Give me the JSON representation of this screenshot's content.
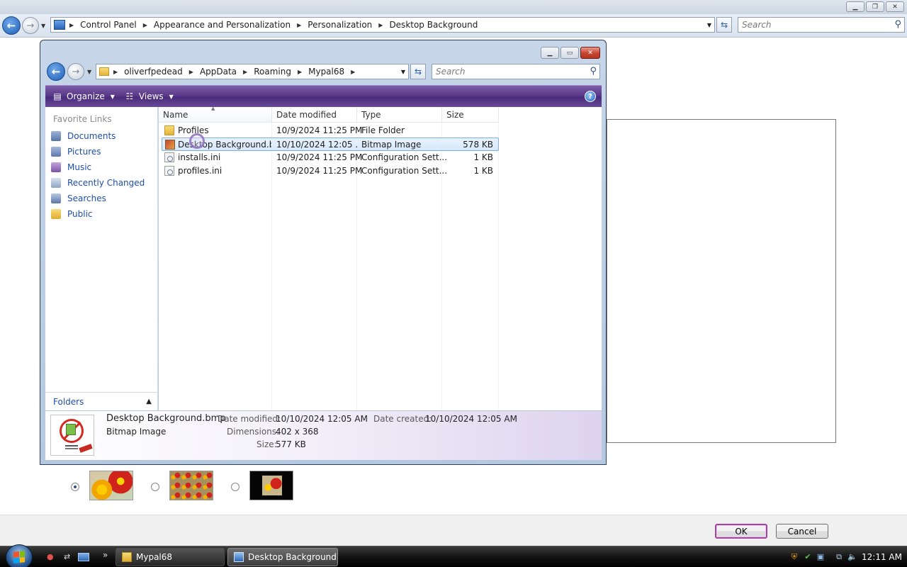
{
  "window": {
    "breadcrumb": [
      "Control Panel",
      "Appearance and Personalization",
      "Personalization",
      "Desktop Background"
    ],
    "search_placeholder": "Search"
  },
  "dialog": {
    "breadcrumb": [
      "oliverfpedead",
      "AppData",
      "Roaming",
      "Mypal68"
    ],
    "search_placeholder": "Search",
    "toolbar": {
      "organize": "Organize",
      "views": "Views"
    },
    "favorites_title": "Favorite Links",
    "favorites": [
      "Documents",
      "Pictures",
      "Music",
      "Recently Changed",
      "Searches",
      "Public"
    ],
    "folders_label": "Folders",
    "columns": {
      "name": "Name",
      "date": "Date modified",
      "type": "Type",
      "size": "Size"
    },
    "files": [
      {
        "name": "Profiles",
        "date": "10/9/2024 11:25 PM",
        "type": "File Folder",
        "size": "",
        "icon": "folder-icon"
      },
      {
        "name": "Desktop Background.b...",
        "date": "10/10/2024 12:05 ...",
        "type": "Bitmap Image",
        "size": "578 KB",
        "icon": "bitmap-file-icon",
        "selected": true
      },
      {
        "name": "installs.ini",
        "date": "10/9/2024 11:25 PM",
        "type": "Configuration Sett...",
        "size": "1 KB",
        "icon": "settings-file-icon"
      },
      {
        "name": "profiles.ini",
        "date": "10/9/2024 11:25 PM",
        "type": "Configuration Sett...",
        "size": "1 KB",
        "icon": "settings-file-icon"
      }
    ],
    "details": {
      "filename": "Desktop Background.bmp",
      "filetype": "Bitmap Image",
      "date_modified_label": "Date modified:",
      "date_modified": "10/10/2024 12:05 AM",
      "date_created_label": "Date created:",
      "date_created": "10/10/2024 12:05 AM",
      "dimensions_label": "Dimensions:",
      "dimensions": "402 x 368",
      "size_label": "Size:",
      "size": "577 KB"
    }
  },
  "positioning": {
    "selected_index": 0,
    "options": [
      "fill-screen",
      "tile",
      "center"
    ]
  },
  "buttons": {
    "ok": "OK",
    "cancel": "Cancel"
  },
  "taskbar": {
    "tasks": [
      "Mypal68",
      "Desktop Background"
    ],
    "clock": "12:11 AM"
  },
  "colors": {
    "command_bar": "#5a3a8a",
    "link": "#1e4fa8",
    "default_button_border": "#a4449a"
  }
}
